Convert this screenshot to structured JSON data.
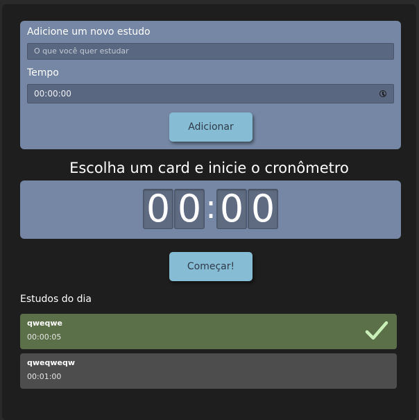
{
  "form": {
    "study_label": "Adicione um novo estudo",
    "study_placeholder": "O que você quer estudar",
    "time_label": "Tempo",
    "time_value": "00:00:00",
    "add_button": "Adicionar"
  },
  "timer": {
    "title": "Escolha um card e inicie o cronômetro",
    "minutes_tens": "0",
    "minutes_ones": "0",
    "separator": ":",
    "seconds_tens": "0",
    "seconds_ones": "0",
    "start_button": "Começar!"
  },
  "list": {
    "title": "Estudos do dia",
    "items": [
      {
        "name": "qweqwe",
        "time": "00:00:05",
        "completed": true,
        "color": "#5b6f48"
      },
      {
        "name": "qweqweqw",
        "time": "00:01:00",
        "completed": false,
        "color": "#4d4d4d"
      }
    ]
  },
  "colors": {
    "panel": "#7587a4",
    "button": "#87bdd4",
    "check": "#c9f0b8"
  },
  "icons": {
    "time_picker": "clock-icon",
    "completed": "check-icon"
  }
}
